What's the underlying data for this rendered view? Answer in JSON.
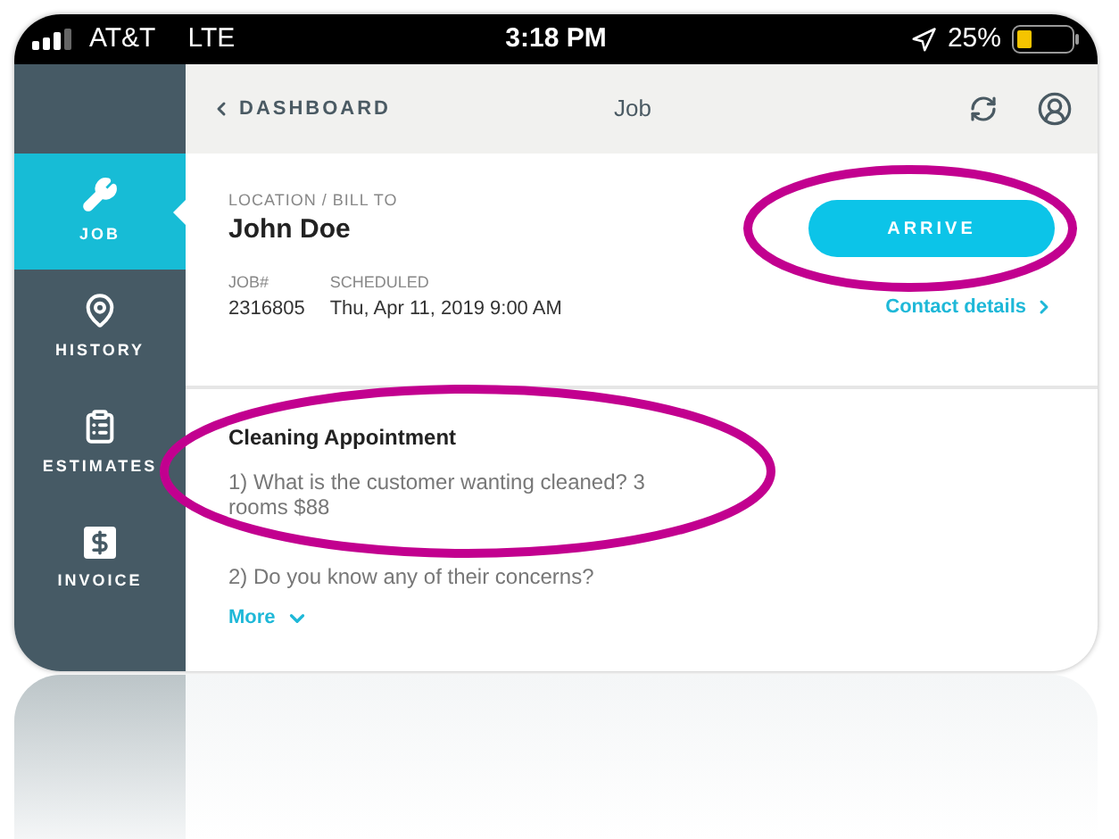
{
  "status_bar": {
    "carrier": "AT&T",
    "network": "LTE",
    "time": "3:18 PM",
    "battery": "25%"
  },
  "sidebar": {
    "items": [
      {
        "kind": "job",
        "label": "JOB",
        "selected": true
      },
      {
        "kind": "history",
        "label": "HISTORY",
        "selected": false
      },
      {
        "kind": "estimates",
        "label": "ESTIMATES",
        "selected": false
      },
      {
        "kind": "invoice",
        "label": "INVOICE",
        "selected": false
      }
    ]
  },
  "header": {
    "back": "DASHBOARD",
    "title": "Job"
  },
  "job": {
    "location_label": "LOCATION / BILL TO",
    "name": "John Doe",
    "job_label": "JOB#",
    "job_number": "2316805",
    "scheduled_label": "SCHEDULED",
    "scheduled": "Thu, Apr 11, 2019 9:00 AM",
    "arrive_button": "ARRIVE",
    "contact_link": "Contact details"
  },
  "notes": {
    "title": "Cleaning Appointment",
    "lines": [
      "1) What is the customer wanting cleaned? 3 rooms $88",
      "2) Do you know any of their concerns?"
    ],
    "more": "More"
  }
}
